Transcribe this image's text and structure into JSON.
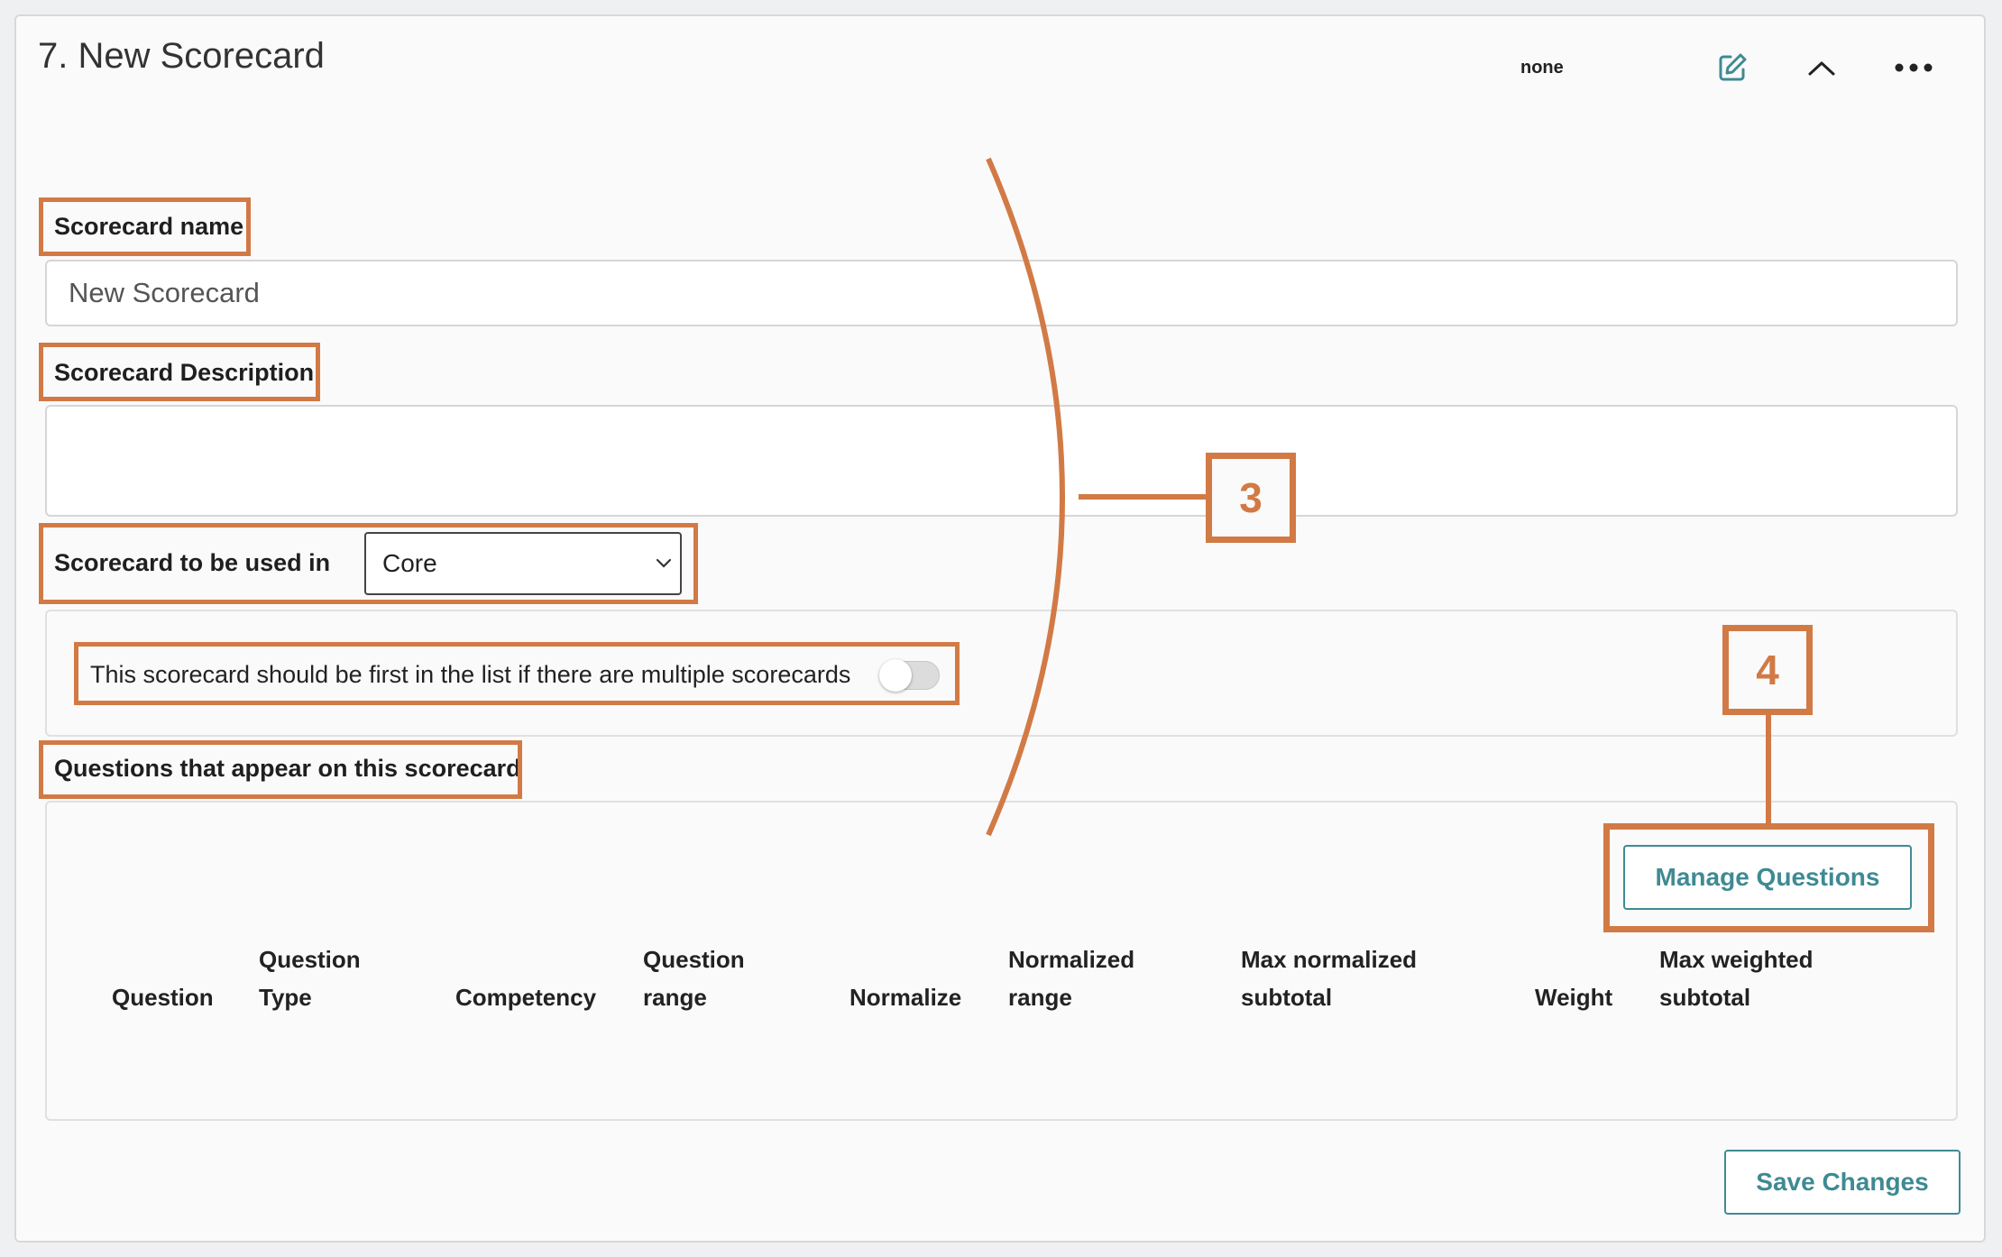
{
  "header": {
    "title": "7. New Scorecard",
    "status_text": "none",
    "icons": [
      "edit-icon",
      "chevron-up-icon",
      "more-icon"
    ]
  },
  "form": {
    "name_label": "Scorecard name",
    "name_value": "New Scorecard",
    "description_label": "Scorecard Description",
    "description_value": "",
    "used_in_label": "Scorecard to be used in",
    "used_in_value": "Core",
    "first_toggle_label": "This scorecard should be first in the list if there are multiple scorecards",
    "first_toggle_on": false,
    "questions_label": "Questions that appear on this scorecard"
  },
  "questions": {
    "manage_button": "Manage Questions",
    "columns": [
      {
        "line1": "",
        "line2": "Question"
      },
      {
        "line1": "Question",
        "line2": "Type"
      },
      {
        "line1": "",
        "line2": "Competency"
      },
      {
        "line1": "Question",
        "line2": "range"
      },
      {
        "line1": "",
        "line2": "Normalize"
      },
      {
        "line1": "Normalized",
        "line2": "range"
      },
      {
        "line1": "Max normalized",
        "line2": "subtotal"
      },
      {
        "line1": "",
        "line2": "Weight"
      },
      {
        "line1": "Max weighted",
        "line2": "subtotal"
      }
    ],
    "rows": []
  },
  "footer": {
    "save_button": "Save Changes"
  },
  "annotations": {
    "callout_3": "3",
    "callout_4": "4",
    "color": "#d27a45"
  },
  "colors": {
    "accent": "#3f8a93",
    "annotation": "#d27a45"
  }
}
